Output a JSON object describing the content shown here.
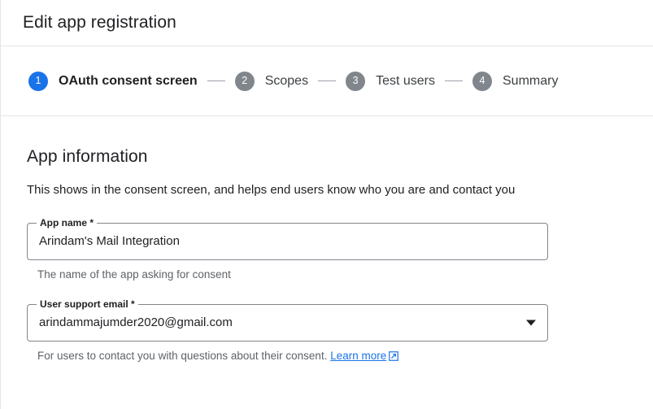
{
  "header": {
    "title": "Edit app registration"
  },
  "stepper": {
    "steps": [
      {
        "number": "1",
        "label": "OAuth consent screen",
        "state": "active"
      },
      {
        "number": "2",
        "label": "Scopes",
        "state": "inactive"
      },
      {
        "number": "3",
        "label": "Test users",
        "state": "inactive"
      },
      {
        "number": "4",
        "label": "Summary",
        "state": "inactive"
      }
    ],
    "active_color": "#1a73e8",
    "inactive_color": "#80868b",
    "connector_color": "#9aa0a6"
  },
  "main": {
    "heading": "App information",
    "description": "This shows in the consent screen, and helps end users know who you are and contact you",
    "fields": [
      {
        "label": "App name *",
        "value": "Arindam's Mail Integration",
        "helper": "The name of the app asking for consent",
        "type": "text"
      },
      {
        "label": "User support email *",
        "value": "arindammajumder2020@gmail.com",
        "helper_prefix": "For users to contact you with questions about their consent.",
        "helper_link": "Learn more",
        "helper_link_icon": "external-link-icon",
        "type": "select"
      }
    ],
    "link_color": "#1a73e8",
    "helper_color": "#5f6368"
  }
}
